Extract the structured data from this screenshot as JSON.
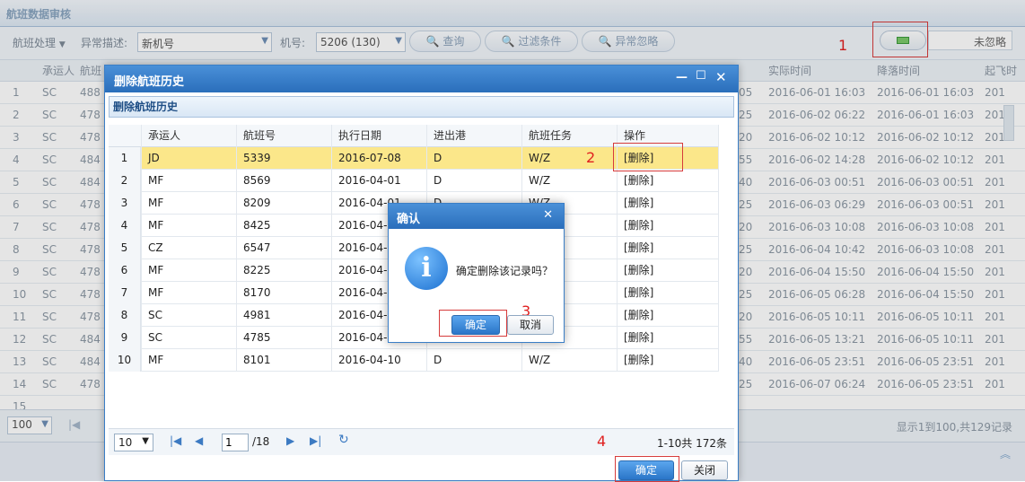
{
  "page": {
    "title": "航班数据审核"
  },
  "toolbar": {
    "process_label": "航班处理",
    "anomaly_label": "异常描述:",
    "anomaly_value": "新机号",
    "tail_label": "机号:",
    "tail_value": "5206 (130)",
    "query_label": "查询",
    "filter_label": "过滤条件",
    "ignore_label": "异常忽略",
    "ignore_status": "未忽略"
  },
  "annotations": [
    "1",
    "2",
    "3",
    "4"
  ],
  "bg_grid": {
    "headers": [
      "承运人",
      "航班",
      "实际时间",
      "降落时间",
      "起飞时"
    ],
    "rows": [
      {
        "n": "1",
        "carrier": "SC",
        "flight": "488",
        "mid": "05",
        "actual": "2016-06-01 16:03",
        "land": "2016-06-01 16:03",
        "dep": "201"
      },
      {
        "n": "2",
        "carrier": "SC",
        "flight": "478",
        "mid": "25",
        "actual": "2016-06-02 06:22",
        "land": "2016-06-01 16:03",
        "dep": "201"
      },
      {
        "n": "3",
        "carrier": "SC",
        "flight": "478",
        "mid": "20",
        "actual": "2016-06-02 10:12",
        "land": "2016-06-02 10:12",
        "dep": "201"
      },
      {
        "n": "4",
        "carrier": "SC",
        "flight": "484",
        "mid": "55",
        "actual": "2016-06-02 14:28",
        "land": "2016-06-02 10:12",
        "dep": "201"
      },
      {
        "n": "5",
        "carrier": "SC",
        "flight": "484",
        "mid": "40",
        "actual": "2016-06-03 00:51",
        "land": "2016-06-03 00:51",
        "dep": "201"
      },
      {
        "n": "6",
        "carrier": "SC",
        "flight": "478",
        "mid": "25",
        "actual": "2016-06-03 06:29",
        "land": "2016-06-03 00:51",
        "dep": "201"
      },
      {
        "n": "7",
        "carrier": "SC",
        "flight": "478",
        "mid": "20",
        "actual": "2016-06-03 10:08",
        "land": "2016-06-03 10:08",
        "dep": "201"
      },
      {
        "n": "8",
        "carrier": "SC",
        "flight": "478",
        "mid": "25",
        "actual": "2016-06-04 10:42",
        "land": "2016-06-03 10:08",
        "dep": "201"
      },
      {
        "n": "9",
        "carrier": "SC",
        "flight": "478",
        "mid": "20",
        "actual": "2016-06-04 15:50",
        "land": "2016-06-04 15:50",
        "dep": "201"
      },
      {
        "n": "10",
        "carrier": "SC",
        "flight": "478",
        "mid": "25",
        "actual": "2016-06-05 06:28",
        "land": "2016-06-04 15:50",
        "dep": "201"
      },
      {
        "n": "11",
        "carrier": "SC",
        "flight": "478",
        "mid": "20",
        "actual": "2016-06-05 10:11",
        "land": "2016-06-05 10:11",
        "dep": "201"
      },
      {
        "n": "12",
        "carrier": "SC",
        "flight": "484",
        "mid": "55",
        "actual": "2016-06-05 13:21",
        "land": "2016-06-05 10:11",
        "dep": "201"
      },
      {
        "n": "13",
        "carrier": "SC",
        "flight": "484",
        "mid": "40",
        "actual": "2016-06-05 23:51",
        "land": "2016-06-05 23:51",
        "dep": "201"
      },
      {
        "n": "14",
        "carrier": "SC",
        "flight": "478",
        "mid": "25",
        "actual": "2016-06-07 06:24",
        "land": "2016-06-05 23:51",
        "dep": "201"
      },
      {
        "n": "15",
        "carrier": "",
        "flight": "",
        "mid": "",
        "actual": "",
        "land": "",
        "dep": ""
      }
    ],
    "page_size": "100",
    "summary": "显示1到100,共129记录"
  },
  "dialog": {
    "title": "删除航班历史",
    "panel_title": "删除航班历史",
    "headers": [
      "承运人",
      "航班号",
      "执行日期",
      "进出港",
      "航班任务",
      "操作"
    ],
    "rows": [
      {
        "n": "1",
        "carrier": "JD",
        "flight": "5339",
        "date": "2016-07-08",
        "io": "D",
        "task": "W/Z",
        "op": "[删除]"
      },
      {
        "n": "2",
        "carrier": "MF",
        "flight": "8569",
        "date": "2016-04-01",
        "io": "D",
        "task": "W/Z",
        "op": "[删除]"
      },
      {
        "n": "3",
        "carrier": "MF",
        "flight": "8209",
        "date": "2016-04-01",
        "io": "D",
        "task": "W/Z",
        "op": "[删除]"
      },
      {
        "n": "4",
        "carrier": "MF",
        "flight": "8425",
        "date": "2016-04-0",
        "io": "",
        "task": "",
        "op": "[删除]"
      },
      {
        "n": "5",
        "carrier": "CZ",
        "flight": "6547",
        "date": "2016-04-0",
        "io": "",
        "task": "",
        "op": "[删除]"
      },
      {
        "n": "6",
        "carrier": "MF",
        "flight": "8225",
        "date": "2016-04-0",
        "io": "",
        "task": "",
        "op": "[删除]"
      },
      {
        "n": "7",
        "carrier": "MF",
        "flight": "8170",
        "date": "2016-04-2",
        "io": "",
        "task": "",
        "op": "[删除]"
      },
      {
        "n": "8",
        "carrier": "SC",
        "flight": "4981",
        "date": "2016-04-0",
        "io": "",
        "task": "",
        "op": "[删除]"
      },
      {
        "n": "9",
        "carrier": "SC",
        "flight": "4785",
        "date": "2016-04-0",
        "io": "",
        "task": "",
        "op": "[删除]"
      },
      {
        "n": "10",
        "carrier": "MF",
        "flight": "8101",
        "date": "2016-04-10",
        "io": "D",
        "task": "W/Z",
        "op": "[删除]"
      }
    ],
    "pager": {
      "page_size": "10",
      "page": "1",
      "total_pages": "/18",
      "summary": "1-10共 172条"
    },
    "ok_label": "确定",
    "close_label": "关闭"
  },
  "confirm": {
    "title": "确认",
    "message": "确定删除该记录吗？",
    "ok_label": "确定",
    "cancel_label": "取消"
  }
}
